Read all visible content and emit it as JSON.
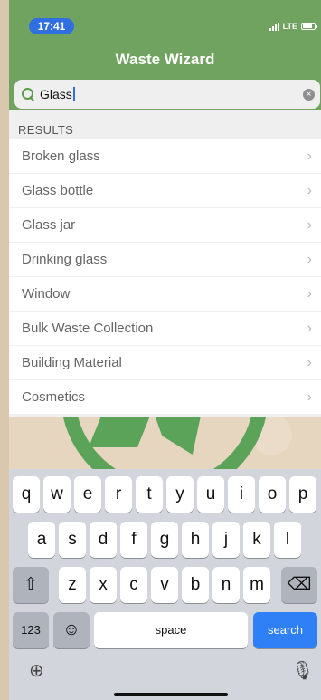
{
  "status": {
    "time": "17:41",
    "network": "LTE"
  },
  "app": {
    "title": "Waste Wizard"
  },
  "search": {
    "value": "Glass",
    "icon": "search-icon",
    "clear_icon": "clear-icon"
  },
  "results": {
    "header": "RESULTS",
    "items": [
      {
        "label": "Broken glass"
      },
      {
        "label": "Glass bottle"
      },
      {
        "label": "Glass jar"
      },
      {
        "label": "Drinking glass"
      },
      {
        "label": "Window"
      },
      {
        "label": "Bulk Waste Collection"
      },
      {
        "label": "Building Material"
      },
      {
        "label": "Cosmetics"
      }
    ]
  },
  "keyboard": {
    "row1": [
      "q",
      "w",
      "e",
      "r",
      "t",
      "y",
      "u",
      "i",
      "o",
      "p"
    ],
    "row2": [
      "a",
      "s",
      "d",
      "f",
      "g",
      "h",
      "j",
      "k",
      "l"
    ],
    "row3": [
      "z",
      "x",
      "c",
      "v",
      "b",
      "n",
      "m"
    ],
    "numbers_label": "123",
    "space_label": "space",
    "search_label": "search"
  },
  "colors": {
    "header": "#6fa35f",
    "accent": "#2f7ff6",
    "background": "#e6d6bf"
  }
}
